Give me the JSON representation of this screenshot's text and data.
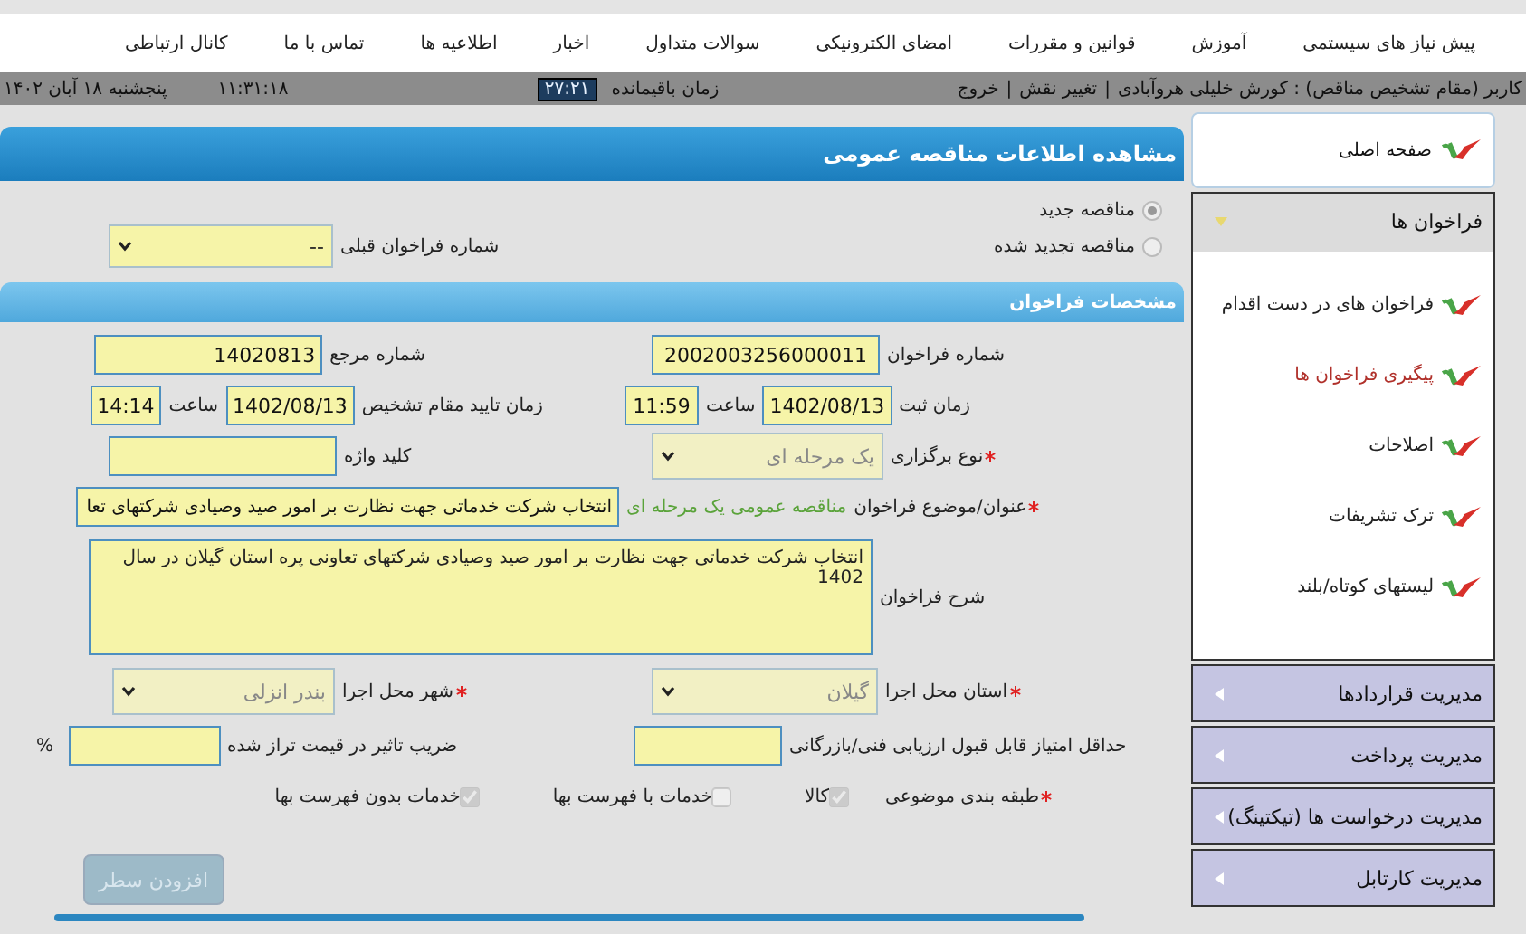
{
  "nav": [
    "پیش نیاز های سیستمی",
    "آموزش",
    "قوانین و مقررات",
    "امضای الکترونیکی",
    "سوالات متداول",
    "اخبار",
    "اطلاعیه ها",
    "تماس با ما",
    "کانال ارتباطی"
  ],
  "user_bar": {
    "user": "کاربر (مقام تشخیص مناقص) : کورش خلیلی هروآبادی",
    "separator": "|",
    "links": [
      "تغییر نقش",
      "خروج"
    ],
    "remaining_label": "زمان باقیمانده",
    "remaining": "۲۷:۲۱",
    "time": "۱۱:۳۱:۱۸",
    "date": "پنجشنبه ۱۸ آبان ۱۴۰۲"
  },
  "page_title": "مشاهده اطلاعات مناقصه عمومی",
  "tender_type": [
    {
      "label": "مناقصه جدید",
      "selected": true,
      "disabled": true
    },
    {
      "label": "مناقصه تجدید شده",
      "selected": false,
      "disabled": true
    }
  ],
  "previous_call": {
    "label": "شماره فراخوان قبلی",
    "value": "--"
  },
  "section_title": "مشخصات فراخوان",
  "call_number": {
    "label": "شماره فراخوان",
    "value": "2002003256000011"
  },
  "reference_number": {
    "label": "شماره مرجع",
    "value": "14020813"
  },
  "registered": {
    "label": "زمان ثبت",
    "date": "1402/08/13",
    "time_label": "ساعت",
    "time": "11:59"
  },
  "approved": {
    "label": "زمان تایید مقام تشخیص",
    "date": "1402/08/13",
    "time_label": "ساعت",
    "time": "14:14"
  },
  "holding_type": {
    "label": "نوع برگزاری",
    "required": true,
    "value": "یک مرحله ای",
    "disabled": true
  },
  "keyword": {
    "label": "کلید واژه"
  },
  "subject": {
    "label": "عنوان/موضوع فراخوان",
    "required": true,
    "prefix": "مناقصه عمومی یک مرحله ای",
    "value": "انتخاب شرکت خدماتی جهت نظارت بر امور صید وصیادی شرکتهای تعا"
  },
  "description": {
    "label": "شرح فراخوان",
    "value": "انتخاب شرکت خدماتی جهت نظارت بر امور صید وصیادی شرکتهای تعاونی پره استان گیلان در سال 1402"
  },
  "province": {
    "label": "استان محل اجرا",
    "required": true,
    "value": "گیلان",
    "disabled": true
  },
  "city": {
    "label": "شهر محل اجرا",
    "required": true,
    "value": "بندر انزلی",
    "disabled": true
  },
  "min_score": {
    "label": "حداقل امتیاز قابل قبول ارزیابی فنی/بازرگانی"
  },
  "price_factor": {
    "label": "ضریب تاثیر در قیمت تراز شده",
    "unit": "%"
  },
  "category": {
    "label": "طبقه بندی موضوعی",
    "required": true,
    "options": [
      {
        "label": "کالا",
        "checked": true,
        "disabled": true
      },
      {
        "label": "خدمات با فهرست بها",
        "checked": false,
        "disabled": true
      },
      {
        "label": "خدمات بدون فهرست بها",
        "checked": true,
        "disabled": true
      }
    ]
  },
  "add_row_button": {
    "label": "افزودن سطر",
    "disabled": true
  },
  "sidebar": {
    "home": "صفحه اصلی",
    "groups": [
      {
        "label": "فراخوان ها",
        "expanded": true,
        "items": [
          {
            "label": "فراخوان های در دست اقدام",
            "selected": false
          },
          {
            "label": "پیگیری فراخوان ها",
            "selected": true
          },
          {
            "label": "اصلاحات",
            "selected": false
          },
          {
            "label": "ترک تشریفات",
            "selected": false
          },
          {
            "label": "لیستهای کوتاه/بلند",
            "selected": false
          }
        ]
      },
      {
        "label": "مدیریت قراردادها",
        "expanded": false
      },
      {
        "label": "مدیریت پرداخت",
        "expanded": false
      },
      {
        "label": "مدیریت درخواست ها (تیکتینگ)",
        "expanded": false
      },
      {
        "label": "مدیریت کارتابل",
        "expanded": false
      }
    ]
  }
}
